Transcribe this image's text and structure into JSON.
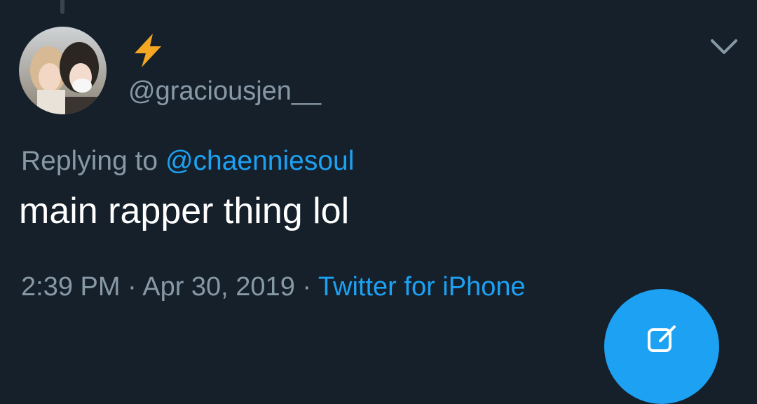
{
  "colors": {
    "background": "#15202b",
    "accent": "#1da1f2",
    "secondary_text": "#8899a6",
    "primary_text": "#ffffff",
    "display_name_emoji": "#f5a623"
  },
  "tweet": {
    "author": {
      "display_name_icon": "lightning-bolt-icon",
      "handle": "@graciousjen__",
      "avatar_icon": "profile-photo"
    },
    "replying_to_label": "Replying to ",
    "replying_to_handle": "@chaenniesoul",
    "text": "main rapper thing lol",
    "time": "2:39 PM",
    "separator": " · ",
    "date": "Apr 30, 2019",
    "source": "Twitter for iPhone"
  },
  "icons": {
    "menu": "chevron-down-icon",
    "compose": "compose-icon"
  }
}
